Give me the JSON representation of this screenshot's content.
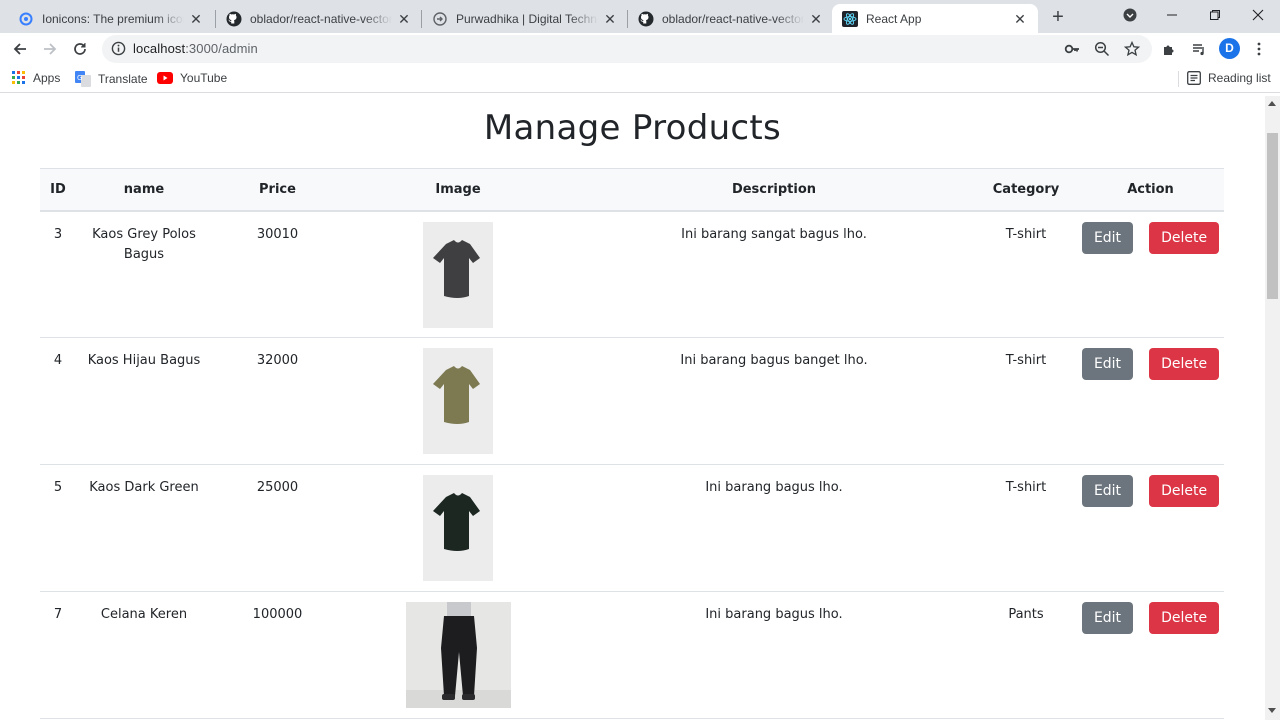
{
  "browser": {
    "tabs": [
      {
        "title": "Ionicons: The premium icon pack",
        "icon": "ionicons-favicon"
      },
      {
        "title": "oblador/react-native-vector-icons",
        "icon": "github-favicon"
      },
      {
        "title": "Purwadhika | Digital Technology School",
        "icon": "purwadhika-favicon"
      },
      {
        "title": "oblador/react-native-vector-icons",
        "icon": "github-favicon"
      },
      {
        "title": "React App",
        "icon": "react-favicon",
        "active": true
      }
    ],
    "address": {
      "host": "localhost",
      "path": ":3000/admin"
    },
    "profile_initial": "D",
    "bookmarks": [
      {
        "label": "Apps",
        "icon": "apps-grid-icon"
      },
      {
        "label": "Translate",
        "icon": "translate-icon"
      },
      {
        "label": "YouTube",
        "icon": "youtube-icon"
      }
    ],
    "reading_list": "Reading list"
  },
  "page": {
    "title": "Manage Products",
    "columns": [
      "ID",
      "name",
      "Price",
      "Image",
      "Description",
      "Category",
      "Action"
    ],
    "rows": [
      {
        "id": "3",
        "name": "Kaos Grey Polos Bagus",
        "price": "30010",
        "image": "grey-tshirt",
        "description": "Ini barang sangat bagus lho.",
        "category": "T-shirt"
      },
      {
        "id": "4",
        "name": "Kaos Hijau Bagus",
        "price": "32000",
        "image": "olive-tshirt",
        "description": "Ini barang bagus banget lho.",
        "category": "T-shirt"
      },
      {
        "id": "5",
        "name": "Kaos Dark Green",
        "price": "25000",
        "image": "dark-green-tshirt",
        "description": "Ini barang bagus lho.",
        "category": "T-shirt"
      },
      {
        "id": "7",
        "name": "Celana Keren",
        "price": "100000",
        "image": "black-pants",
        "description": "Ini barang bagus lho.",
        "category": "Pants"
      }
    ],
    "actions": {
      "edit": "Edit",
      "delete": "Delete"
    }
  },
  "colors": {
    "edit": "#6c757d",
    "delete": "#dc3545",
    "header_bg": "#f8f9fa",
    "tab_bar": "#dee1e6"
  }
}
